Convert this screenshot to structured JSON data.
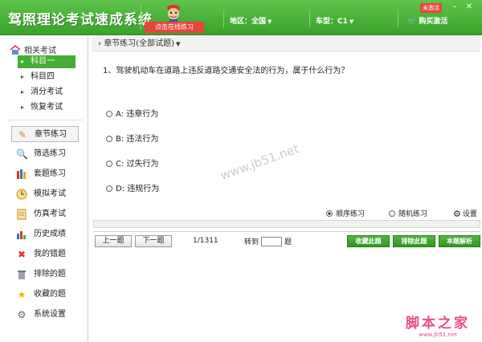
{
  "header": {
    "title": "驾照理论考试速成系统",
    "trial_button": "点击在线练习",
    "region": "地区：全国",
    "car_type": "车型：C1",
    "buy": "购买激活",
    "not_activated": "未激活",
    "brand_color": "#3aa12c",
    "accent_red": "#e8463d"
  },
  "sidebar": {
    "section_title": "相关考试",
    "sub_items": [
      {
        "label": "科目一"
      },
      {
        "label": "科目四"
      },
      {
        "label": "消分考试"
      },
      {
        "label": "恢复考试"
      }
    ],
    "nav_items": [
      {
        "label": "章节练习",
        "icon": "pencil-icon"
      },
      {
        "label": "筛选练习",
        "icon": "magnifier-icon"
      },
      {
        "label": "套题练习",
        "icon": "books-icon"
      },
      {
        "label": "模拟考试",
        "icon": "clock-icon"
      },
      {
        "label": "仿真考试",
        "icon": "exam-paper-icon"
      },
      {
        "label": "历史成绩",
        "icon": "bar-chart-icon"
      },
      {
        "label": "我的错题",
        "icon": "red-x-icon"
      },
      {
        "label": "排除的题",
        "icon": "trash-icon"
      },
      {
        "label": "收藏的题",
        "icon": "star-icon"
      },
      {
        "label": "系统设置",
        "icon": "gear-icon"
      }
    ]
  },
  "main": {
    "breadcrumb": "章节练习(全部试题)",
    "question": "1、驾驶机动车在道路上违反道路交通安全法的行为，属于什么行为？",
    "options": [
      {
        "label": "A: 违章行为"
      },
      {
        "label": "B: 违法行为"
      },
      {
        "label": "C: 过失行为"
      },
      {
        "label": "D: 违规行为"
      }
    ],
    "watermark": "www.jb51.net",
    "mode_sequential": "顺序练习",
    "mode_random": "随机练习",
    "settings": "设置",
    "prev_button": "上一题",
    "next_button": "下一题",
    "page_count": "1/1311",
    "goto_label": "转到",
    "goto_suffix": "题",
    "collect_button": "收藏此题",
    "exclude_button": "排除此题",
    "explain_button": "本题解析"
  },
  "footer": {
    "brand": "脚本之家",
    "url": "www.jb51.net"
  }
}
